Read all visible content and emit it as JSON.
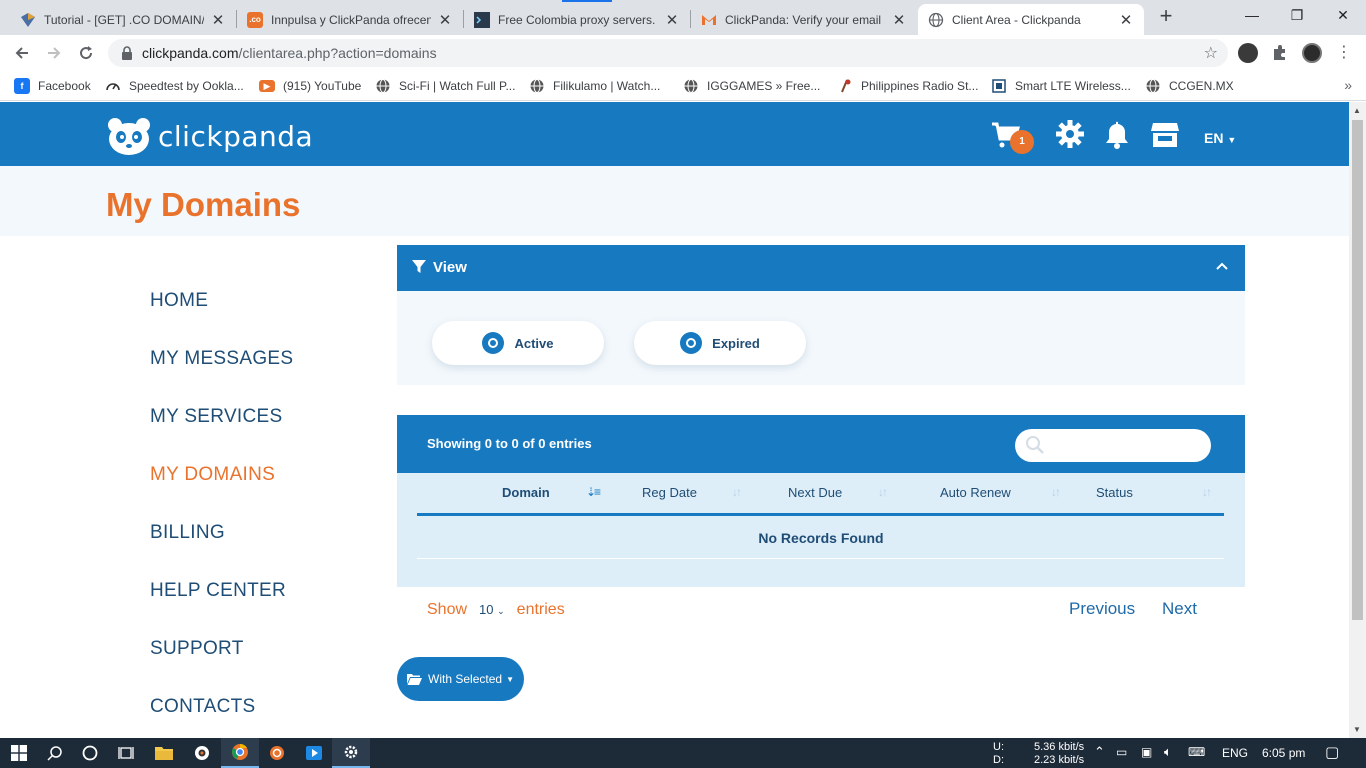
{
  "browser": {
    "tabs": [
      {
        "title": "Tutorial - [GET] .CO DOMAIN/r",
        "favicon": "vortex-icon",
        "active": false
      },
      {
        "title": "Innpulsa y ClickPanda ofrecen",
        "favicon": "co-icon",
        "active": false
      },
      {
        "title": "Free Colombia proxy servers.",
        "favicon": "terminal-icon",
        "active": false
      },
      {
        "title": "ClickPanda: Verify your email a",
        "favicon": "gmail-icon",
        "active": false
      },
      {
        "title": "Client Area - Clickpanda",
        "favicon": "globe-icon",
        "active": true
      }
    ],
    "url_host": "clickpanda.com",
    "url_path": "/clientarea.php?action=domains",
    "bookmarks": [
      {
        "label": "Facebook",
        "icon": "facebook-icon"
      },
      {
        "label": "Speedtest by Ookla...",
        "icon": "speedtest-icon"
      },
      {
        "label": "(915) YouTube",
        "icon": "youtube-icon"
      },
      {
        "label": "Sci-Fi | Watch Full P...",
        "icon": "globe-icon"
      },
      {
        "label": "Filikulamo | Watch...",
        "icon": "globe-icon"
      },
      {
        "label": "IGGGAMES » Free...",
        "icon": "globe-icon"
      },
      {
        "label": "Philippines Radio St...",
        "icon": "radio-icon"
      },
      {
        "label": "Smart LTE Wireless...",
        "icon": "router-icon"
      },
      {
        "label": "CCGEN.MX",
        "icon": "globe-icon"
      }
    ]
  },
  "site": {
    "brand": "clickpanda",
    "cart_count": "1",
    "language": "EN",
    "page_title": "My Domains",
    "accent": "#e9732d",
    "primary": "#1779c0"
  },
  "sidebar": {
    "items": [
      {
        "label": "HOME",
        "active": false
      },
      {
        "label": "MY MESSAGES",
        "active": false
      },
      {
        "label": "MY SERVICES",
        "active": false
      },
      {
        "label": "MY DOMAINS",
        "active": true
      },
      {
        "label": "BILLING",
        "active": false
      },
      {
        "label": "HELP CENTER",
        "active": false
      },
      {
        "label": "SUPPORT",
        "active": false
      },
      {
        "label": "CONTACTS",
        "active": false
      }
    ]
  },
  "view_panel": {
    "title": "View",
    "filters": [
      "Active",
      "Expired"
    ]
  },
  "table": {
    "info": "Showing 0 to 0 of 0 entries",
    "search_value": "",
    "columns": [
      "Domain",
      "Reg Date",
      "Next Due",
      "Auto Renew",
      "Status"
    ],
    "sorted_column": "Domain",
    "empty_message": "No Records Found",
    "show_label": "Show",
    "page_size": "10",
    "entries_label": "entries",
    "previous": "Previous",
    "next": "Next"
  },
  "bulk": {
    "with_selected": "With Selected"
  },
  "taskbar": {
    "net_up_label": "U:",
    "net_down_label": "D:",
    "net_up": "5.36 kbit/s",
    "net_down": "2.23 kbit/s",
    "lang": "ENG",
    "time": "6:05 pm"
  }
}
